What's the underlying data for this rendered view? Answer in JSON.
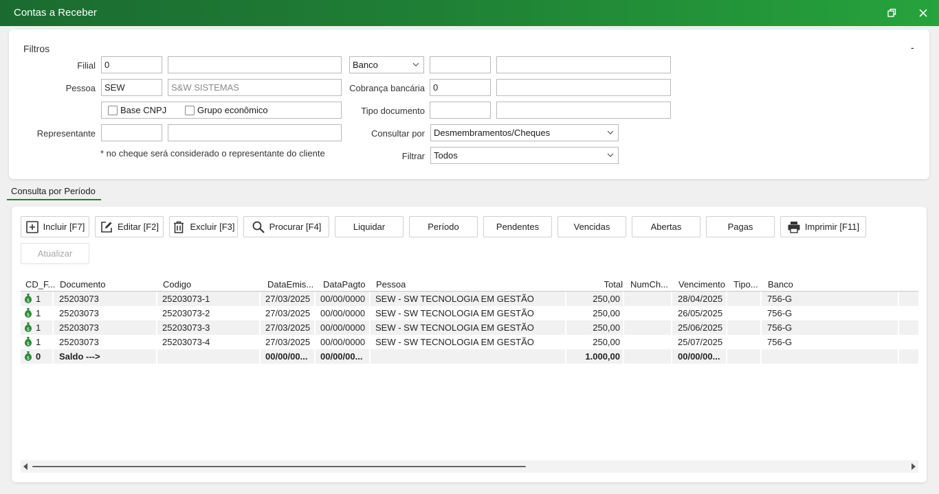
{
  "window": {
    "title": "Contas a Receber"
  },
  "filters": {
    "heading": "Filtros",
    "collapse_label": "-",
    "filial_label": "Filial",
    "filial_code": "0",
    "filial_name": "",
    "banco_select": "Banco",
    "banco_code": "",
    "banco_name": "",
    "pessoa_label": "Pessoa",
    "pessoa_code": "SEW",
    "pessoa_name": "S&W SISTEMAS",
    "cobranca_label": "Cobrança bancária",
    "cobranca_code": "0",
    "cobranca_name": "",
    "base_cnpj_label": "Base CNPJ",
    "grupo_label": "Grupo econômico",
    "tipo_doc_label": "Tipo documento",
    "tipo_doc_code": "",
    "tipo_doc_name": "",
    "representante_label": "Representante",
    "representante_code": "",
    "representante_name": "",
    "consultar_label": "Consultar por",
    "consultar_value": "Desmembramentos/Cheques",
    "note": "* no cheque será considerado o representante do cliente",
    "filtrar_label": "Filtrar",
    "filtrar_value": "Todos"
  },
  "tab": {
    "label": "Consulta por Período"
  },
  "toolbar": {
    "incluir": "Incluir [F7]",
    "editar": "Editar [F2]",
    "excluir": "Excluir [F3]",
    "procurar": "Procurar [F4]",
    "liquidar": "Liquidar",
    "periodo": "Período",
    "pendentes": "Pendentes",
    "vencidas": "Vencidas",
    "abertas": "Abertas",
    "pagas": "Pagas",
    "imprimir": "Imprimir [F11]",
    "atualizar": "Atualizar"
  },
  "grid": {
    "columns": [
      "CD_F...",
      "Documento",
      "Codigo",
      "DataEmis...",
      "DataPagto",
      "Pessoa",
      "Total",
      "NumCh...",
      "Vencimento",
      "Tipo...",
      "Banco"
    ],
    "rows": [
      {
        "cd": "1",
        "documento": "25203073",
        "codigo": "25203073-1",
        "emissao": "27/03/2025",
        "pagto": "00/00/0000",
        "pessoa": "SEW - SW TECNOLOGIA EM GESTÃO",
        "total": "250,00",
        "numch": "",
        "vencimento": "28/04/2025",
        "tipo": "",
        "banco": "756-G"
      },
      {
        "cd": "1",
        "documento": "25203073",
        "codigo": "25203073-2",
        "emissao": "27/03/2025",
        "pagto": "00/00/0000",
        "pessoa": "SEW - SW TECNOLOGIA EM GESTÃO",
        "total": "250,00",
        "numch": "",
        "vencimento": "26/05/2025",
        "tipo": "",
        "banco": "756-G"
      },
      {
        "cd": "1",
        "documento": "25203073",
        "codigo": "25203073-3",
        "emissao": "27/03/2025",
        "pagto": "00/00/0000",
        "pessoa": "SEW - SW TECNOLOGIA EM GESTÃO",
        "total": "250,00",
        "numch": "",
        "vencimento": "25/06/2025",
        "tipo": "",
        "banco": "756-G"
      },
      {
        "cd": "1",
        "documento": "25203073",
        "codigo": "25203073-4",
        "emissao": "27/03/2025",
        "pagto": "00/00/0000",
        "pessoa": "SEW - SW TECNOLOGIA EM GESTÃO",
        "total": "250,00",
        "numch": "",
        "vencimento": "25/07/2025",
        "tipo": "",
        "banco": "756-G"
      }
    ],
    "total_row": {
      "cd": "0",
      "documento": "Saldo --->",
      "codigo": "",
      "emissao": "00/00/00...",
      "pagto": "00/00/00...",
      "pessoa": "",
      "total": "1.000,00",
      "numch": "",
      "vencimento": "00/00/00...",
      "tipo": "",
      "banco": ""
    }
  },
  "icons": {
    "restore": "restore-icon",
    "close": "close-icon",
    "incluir": "add-square-icon",
    "editar": "edit-icon",
    "excluir": "trash-icon",
    "procurar": "search-icon",
    "imprimir": "printer-icon",
    "row_marker": "money-bag-icon"
  },
  "colors": {
    "titlebar_dark": "#1b6b30",
    "titlebar_light": "#26a33c",
    "money_icon": "#2e8b3a"
  }
}
